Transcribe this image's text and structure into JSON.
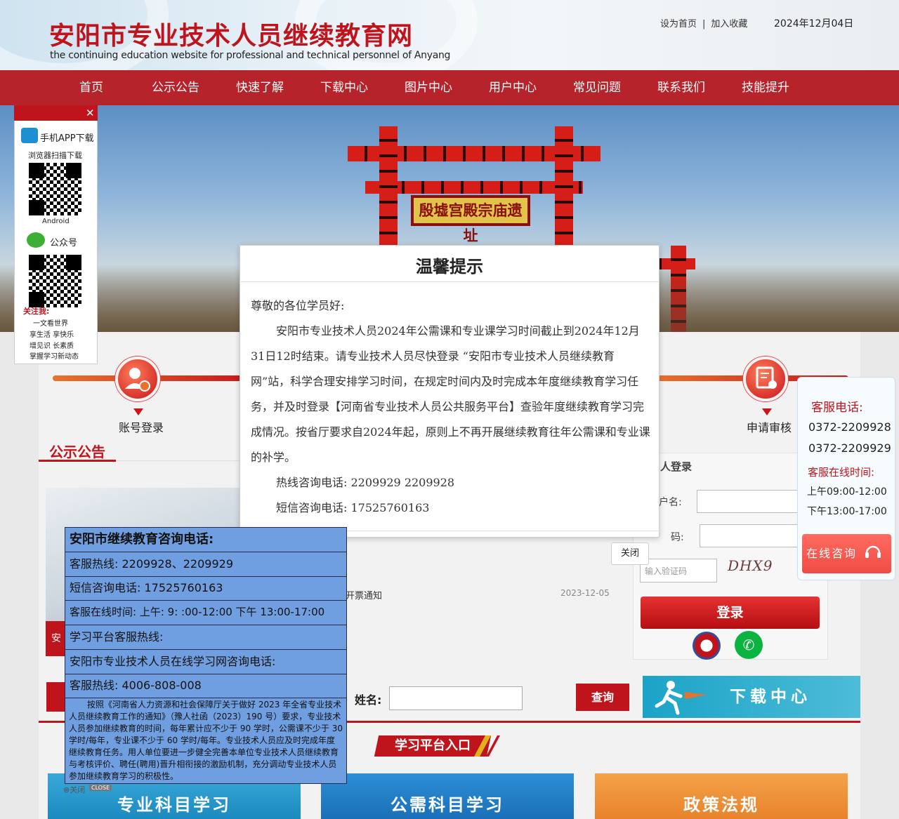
{
  "header": {
    "title": "安阳市专业技术人员继续教育网",
    "subtitle": "the continuing education website for professional and technical personnel of Anyang",
    "set_home": "设为首页",
    "separator": "|",
    "favorite": "加入收藏",
    "date": "2024年12月04日"
  },
  "nav": {
    "items": [
      "首页",
      "公示公告",
      "快速了解",
      "下载中心",
      "图片中心",
      "用户中心",
      "常见问题",
      "联系我们",
      "技能提升"
    ]
  },
  "banner": {
    "sign_text": "殷墟宫殿宗庙遗址"
  },
  "steps": {
    "account_login": "账号登录",
    "apply_review": "申请审核"
  },
  "notices": {
    "heading": "公示公告",
    "photo_tag": "安",
    "row_1_title": "开票通知",
    "row_1_date": "2023-12-05"
  },
  "login": {
    "title": "人登录",
    "username_label": "户名:",
    "password_label": "码:",
    "captcha_placeholder": "输入验证码",
    "captcha_text": "DHX9",
    "submit": "登录"
  },
  "query": {
    "name_label": "姓名:",
    "button": "查询"
  },
  "download_banner": "下载中心",
  "platform": {
    "title": "学习平台入口",
    "cards": [
      "专业科目学习",
      "公需科目学习",
      "政策法规"
    ]
  },
  "left_float": {
    "app_title": "手机APP下载",
    "scan_hint": "浏览器扫描下载",
    "android": "Android",
    "wechat": "公众号",
    "follow": "关注我:",
    "slogans": [
      "一文看世界",
      "享生活  享快乐",
      "增见识  长素质",
      "掌握学习新动态"
    ]
  },
  "right_float": {
    "title": "客服电话:",
    "phones": [
      "0372-2209928",
      "0372-2209929"
    ],
    "hours_title": "客服在线时间:",
    "hours": [
      "上午09:00-12:00",
      "下午13:00-17:00"
    ],
    "button": "在线咨询"
  },
  "modal": {
    "title": "温馨提示",
    "greeting": "尊敬的各位学员好:",
    "body": "安阳市专业技术人员2024年公需课和专业课学习时间截止到2024年12月31日12时结束。请专业技术人员尽快登录 “安阳市专业技术人员继续教育网”站，科学合理安排学习时间，在规定时间内及时完成本年度继续教育学习任务，并及时登录【河南省专业技术人员公共服务平台】查验年度继续教育学习完成情况。按省厅要求自2024年起，原则上不再开展继续教育往年公需课和专业课的补学。",
    "hotline": "热线咨询电话: 2209929 2209928",
    "sms": "短信咨询电话: 17525760163",
    "close": "关闭"
  },
  "consult": {
    "rows": [
      "安阳市继续教育咨询电话:",
      "客服热线: 2209928、2209929",
      "短信咨询电话: 17525760163",
      "客服在线时间: 上午: 9: :00-12:00 下午 13:00-17:00",
      "学习平台客服热线:",
      "安阳市专业技术人员在线学习网咨询电话:",
      "客服热线: 4006-808-008"
    ],
    "paragraph": "按照《河南省人力资源和社会保障厅关于做好 2023 年全省专业技术人员继续教育工作的通知》（豫人社函（2023）190 号）要求，专业技术人员参加继续教育的时间，每年累计应不少于 90 学时，公需课不少于 30 学时/每年，专业课不少于 60 学时/每年。专业技术人员应及时完成年度继续教育任务。用人单位要进一步健全完善本单位专业技术人员继续教育与考核评价、聘任(聘用)晋升相衔接的激励机制，充分调动专业技术人员参加继续教育学习的积极性。",
    "close": "关闭",
    "close_tag": "CLOSE"
  }
}
